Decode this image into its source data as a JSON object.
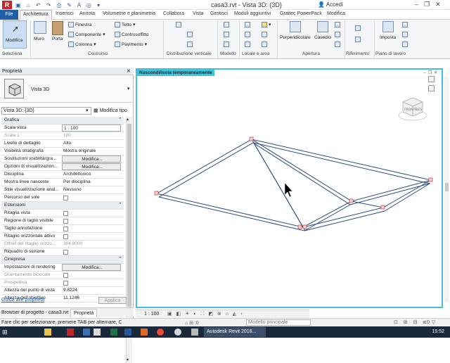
{
  "titlebar": {
    "doc_title": "casa3.rvt - Vista 3D: {3D}",
    "login": "Accedi",
    "qat_glyphs": "▣ ⌂ ↶ ↷ ⎙ ✎ A ◎ ▾"
  },
  "tabs": [
    "File",
    "Architettura",
    "Inserisci",
    "Annota",
    "Volumetrie e planimetria",
    "Collabora",
    "Vista",
    "Gestisci",
    "Moduli aggiuntivi",
    "Graitec PowerPack",
    "Modifica"
  ],
  "ribbon": {
    "modify": "Modifica",
    "wall": "Muro",
    "door": "Porta",
    "window": "Finestra",
    "component": "Componente",
    "column": "Colonna",
    "roof": "Tetto",
    "ceiling": "Controsoffitto",
    "floor": "Pavimento",
    "perpendicular": "Perpendicolare",
    "shaft": "Cavedio",
    "set": "Imposta",
    "groups": {
      "select": "Seleziona",
      "build": "Costruisci",
      "circulation": "Distribuzione verticale",
      "model": "Modello",
      "room": "Locale e area",
      "opening": "Apertura",
      "datum": "Riferimento",
      "workplane": "Piano di lavoro"
    }
  },
  "properties": {
    "panel_title": "Proprietà",
    "type_name": "Vista 3D",
    "instance_select": "Vista 3D: {3D}",
    "edit_type": "Modifica tipo",
    "help_link": "Guida alle proprietà",
    "apply": "Applica",
    "groups": {
      "graphics": "Grafica",
      "extents": "Estensioni",
      "camera": "Cinepresa"
    },
    "graphics_rows": [
      {
        "k": "Scala vista",
        "v": "1 : 100"
      },
      {
        "k": "Scala  1:",
        "v": "100"
      },
      {
        "k": "Livello di dettaglio",
        "v": "Alto"
      },
      {
        "k": "Visibilità stratigrafia",
        "v": "Mostra originale"
      },
      {
        "k": "Sostituzioni visibilità/gra...",
        "v": "Modifica..."
      },
      {
        "k": "Opzioni di visualizzazion...",
        "v": "Modifica..."
      },
      {
        "k": "Disciplina",
        "v": "Architettonico"
      },
      {
        "k": "Mostra linee nascoste",
        "v": "Per disciplina"
      },
      {
        "k": "Stile visualizzazione anal...",
        "v": "Nessuno"
      },
      {
        "k": "Percorso del sole",
        "v": ""
      }
    ],
    "extent_rows": [
      {
        "k": "Ritaglia vista",
        "v": ""
      },
      {
        "k": "Regione di taglio visibile",
        "v": ""
      },
      {
        "k": "Taglio annotazione",
        "v": ""
      },
      {
        "k": "Ritaglio orizzontale attivo",
        "v": ""
      },
      {
        "k": "Offset del ritaglio orizzo...",
        "v": "304.8000"
      },
      {
        "k": "Riquadro di sezione",
        "v": ""
      }
    ],
    "camera_rows": [
      {
        "k": "Impostazioni di rendering",
        "v": "Modifica..."
      },
      {
        "k": "Orientamento bloccato",
        "v": ""
      },
      {
        "k": "Prospettiva",
        "v": ""
      },
      {
        "k": "Altezza del punto di vista",
        "v": "9.8224"
      },
      {
        "k": "Altezza dell'obiettivo",
        "v": "11.1246"
      }
    ]
  },
  "bottom_tabs": {
    "browser": "Browser di progetto - casa3.rvt",
    "props": "Proprietà"
  },
  "viewport": {
    "header": "Nascondi/Isola temporaneamente",
    "viewcube_front": "FRONTE",
    "viewcube_right": "DES"
  },
  "viewbar": {
    "scale": "1 : 100"
  },
  "status": {
    "message": "Fare clic per selezionare, premere TAB per alternare, C",
    "model": "Modello principale",
    "filter_count": ":0"
  },
  "taskbar": {
    "app": "Autodesk Revit 2018...",
    "clock": "15:52"
  },
  "colors": {
    "accent": "#1e5fa8",
    "viewport_border": "#3fc3d8",
    "roof_line": "#2b4a80"
  }
}
